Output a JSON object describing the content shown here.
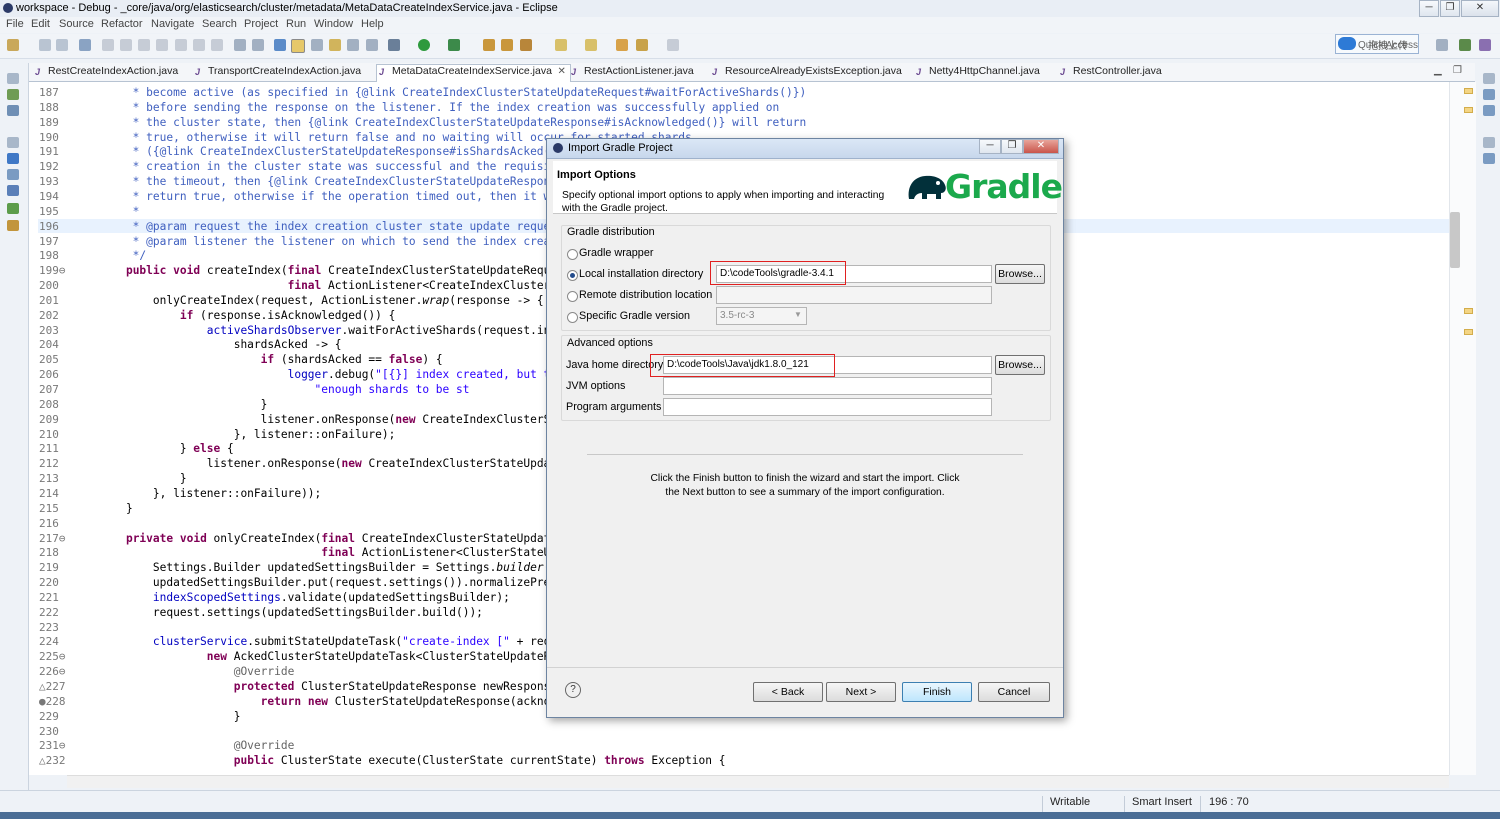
{
  "window": {
    "title": "workspace - Debug - _core/java/org/elasticsearch/cluster/metadata/MetaDataCreateIndexService.java - Eclipse",
    "controls": [
      "─",
      "❐",
      "✕"
    ]
  },
  "menu": [
    "File",
    "Edit",
    "Source",
    "Refactor",
    "Navigate",
    "Search",
    "Project",
    "Run",
    "Window",
    "Help"
  ],
  "toolbar": {
    "quick_access": "Quick Access",
    "cloud_label": "拖拽上传"
  },
  "tabs": [
    {
      "label": "RestCreateIndexAction.java",
      "active": false
    },
    {
      "label": "TransportCreateIndexAction.java",
      "active": false
    },
    {
      "label": "MetaDataCreateIndexService.java",
      "active": true
    },
    {
      "label": "RestActionListener.java",
      "active": false
    },
    {
      "label": "ResourceAlreadyExistsException.java",
      "active": false
    },
    {
      "label": "Netty4HttpChannel.java",
      "active": false
    },
    {
      "label": "RestController.java",
      "active": false
    }
  ],
  "editor": {
    "lines": [
      {
        "n": "187",
        "segs": [
          [
            "cm",
            "     * become active (as specified in {@link CreateIndexClusterStateUpdateRequest#waitForActiveShards()})"
          ]
        ]
      },
      {
        "n": "188",
        "segs": [
          [
            "cm",
            "     * before sending the response on the listener. If the index creation was successfully applied on"
          ]
        ]
      },
      {
        "n": "189",
        "segs": [
          [
            "cm",
            "     * the cluster state, then {@link CreateIndexClusterStateUpdateResponse#isAcknowledged()} will return"
          ]
        ]
      },
      {
        "n": "190",
        "segs": [
          [
            "cm",
            "     * true, otherwise it will return false and no waiting will occur for started shards"
          ]
        ]
      },
      {
        "n": "191",
        "segs": [
          [
            "cm",
            "     * ({@link CreateIndexClusterStateUpdateResponse#isShardsAcked()"
          ]
        ]
      },
      {
        "n": "192",
        "segs": [
          [
            "cm",
            "     * creation in the cluster state was successful and the requisite"
          ]
        ]
      },
      {
        "n": "193",
        "segs": [
          [
            "cm",
            "     * the timeout, then {@link CreateIndexClusterStateUpdateRespons"
          ]
        ]
      },
      {
        "n": "194",
        "segs": [
          [
            "cm",
            "     * return true, otherwise if the operation timed out, then it wi"
          ]
        ]
      },
      {
        "n": "195",
        "segs": [
          [
            "cm",
            "     *"
          ]
        ]
      },
      {
        "n": "196",
        "hl": true,
        "segs": [
          [
            "cm",
            "     * @param request the index creation cluster state update reques"
          ]
        ]
      },
      {
        "n": "197",
        "segs": [
          [
            "cm",
            "     * @param listener the listener on which to send the index creat"
          ]
        ]
      },
      {
        "n": "198",
        "segs": [
          [
            "cm",
            "     */"
          ]
        ]
      },
      {
        "n": "199⊖",
        "segs": [
          [
            "",
            "    "
          ],
          [
            "kw",
            "public"
          ],
          [
            "",
            " "
          ],
          [
            "kw",
            "void"
          ],
          [
            "",
            " createIndex("
          ],
          [
            "kw",
            "final"
          ],
          [
            "",
            " CreateIndexClusterStateUpdateReque"
          ]
        ]
      },
      {
        "n": "200",
        "segs": [
          [
            "",
            "                            "
          ],
          [
            "kw",
            "final"
          ],
          [
            "",
            " ActionListener<CreateIndexClusterS"
          ]
        ]
      },
      {
        "n": "201",
        "segs": [
          [
            "",
            "        onlyCreateIndex(request, ActionListener."
          ],
          [
            "it",
            "wrap"
          ],
          [
            "",
            "(response -> {"
          ]
        ]
      },
      {
        "n": "202",
        "segs": [
          [
            "",
            "            "
          ],
          [
            "kw",
            "if"
          ],
          [
            "",
            " (response.isAcknowledged()) {"
          ]
        ]
      },
      {
        "n": "203",
        "segs": [
          [
            "",
            "                "
          ],
          [
            "fld",
            "activeShardsObserver"
          ],
          [
            "",
            ".waitForActiveShards(request.ind"
          ]
        ]
      },
      {
        "n": "204",
        "segs": [
          [
            "",
            "                    shardsAcked -> {"
          ]
        ]
      },
      {
        "n": "205",
        "segs": [
          [
            "",
            "                        "
          ],
          [
            "kw",
            "if"
          ],
          [
            "",
            " (shardsAcked == "
          ],
          [
            "kw",
            "false"
          ],
          [
            "",
            ") {"
          ]
        ]
      },
      {
        "n": "206",
        "segs": [
          [
            "",
            "                            "
          ],
          [
            "fld",
            "logger"
          ],
          [
            "",
            ".debug("
          ],
          [
            "str",
            "\"[{}] index created, but th"
          ]
        ]
      },
      {
        "n": "207",
        "segs": [
          [
            "",
            "                                "
          ],
          [
            "str",
            "\"enough shards to be st"
          ]
        ]
      },
      {
        "n": "208",
        "segs": [
          [
            "",
            "                        }"
          ]
        ]
      },
      {
        "n": "209",
        "segs": [
          [
            "",
            "                        listener.onResponse("
          ],
          [
            "kw",
            "new"
          ],
          [
            "",
            " CreateIndexClusterSt"
          ]
        ]
      },
      {
        "n": "210",
        "segs": [
          [
            "",
            "                    }, listener::onFailure);"
          ]
        ]
      },
      {
        "n": "211",
        "segs": [
          [
            "",
            "            } "
          ],
          [
            "kw",
            "else"
          ],
          [
            "",
            " {"
          ]
        ]
      },
      {
        "n": "212",
        "segs": [
          [
            "",
            "                listener.onResponse("
          ],
          [
            "kw",
            "new"
          ],
          [
            "",
            " CreateIndexClusterStateUpdat"
          ]
        ]
      },
      {
        "n": "213",
        "segs": [
          [
            "",
            "            }"
          ]
        ]
      },
      {
        "n": "214",
        "segs": [
          [
            "",
            "        }, listener::onFailure));"
          ]
        ]
      },
      {
        "n": "215",
        "segs": [
          [
            "",
            "    }"
          ]
        ]
      },
      {
        "n": "216",
        "segs": [
          [
            "",
            ""
          ]
        ]
      },
      {
        "n": "217⊖",
        "segs": [
          [
            "",
            "    "
          ],
          [
            "kw",
            "private"
          ],
          [
            "",
            " "
          ],
          [
            "kw",
            "void"
          ],
          [
            "",
            " onlyCreateIndex("
          ],
          [
            "kw",
            "final"
          ],
          [
            "",
            " CreateIndexClusterStateUpdate"
          ]
        ]
      },
      {
        "n": "218",
        "segs": [
          [
            "",
            "                                 "
          ],
          [
            "kw",
            "final"
          ],
          [
            "",
            " ActionListener<ClusterStateUp"
          ]
        ]
      },
      {
        "n": "219",
        "segs": [
          [
            "",
            "        Settings.Builder updatedSettingsBuilder = Settings."
          ],
          [
            "it",
            "builder"
          ],
          [
            "",
            "()"
          ]
        ]
      },
      {
        "n": "220",
        "segs": [
          [
            "",
            "        updatedSettingsBuilder.put(request.settings()).normalizePref"
          ]
        ]
      },
      {
        "n": "221",
        "segs": [
          [
            "",
            "        "
          ],
          [
            "fld",
            "indexScopedSettings"
          ],
          [
            "",
            ".validate(updatedSettingsBuilder);"
          ]
        ]
      },
      {
        "n": "222",
        "segs": [
          [
            "",
            "        request.settings(updatedSettingsBuilder.build());"
          ]
        ]
      },
      {
        "n": "223",
        "segs": [
          [
            "",
            ""
          ]
        ]
      },
      {
        "n": "224",
        "segs": [
          [
            "",
            "        "
          ],
          [
            "fld",
            "clusterService"
          ],
          [
            "",
            ".submitStateUpdateTask("
          ],
          [
            "str",
            "\"create-index [\""
          ],
          [
            "",
            " + requ"
          ]
        ]
      },
      {
        "n": "225⊖",
        "segs": [
          [
            "",
            "                "
          ],
          [
            "kw",
            "new"
          ],
          [
            "",
            " AckedClusterStateUpdateTask<ClusterStateUpdateRe"
          ]
        ]
      },
      {
        "n": "226⊖",
        "segs": [
          [
            "ann",
            "                    @Override"
          ]
        ]
      },
      {
        "n": "△227",
        "segs": [
          [
            "",
            "                    "
          ],
          [
            "kw",
            "protected"
          ],
          [
            "",
            " ClusterStateUpdateResponse newResponse"
          ]
        ]
      },
      {
        "n": "●228",
        "segs": [
          [
            "",
            "                        "
          ],
          [
            "kw",
            "return"
          ],
          [
            "",
            " "
          ],
          [
            "kw",
            "new"
          ],
          [
            "",
            " ClusterStateUpdateResponse(ackno"
          ]
        ]
      },
      {
        "n": "229",
        "segs": [
          [
            "",
            "                    }"
          ]
        ]
      },
      {
        "n": "230",
        "segs": [
          [
            "",
            ""
          ]
        ]
      },
      {
        "n": "231⊖",
        "segs": [
          [
            "ann",
            "                    @Override"
          ]
        ]
      },
      {
        "n": "△232",
        "segs": [
          [
            "",
            "                    "
          ],
          [
            "kw",
            "public"
          ],
          [
            "",
            " ClusterState execute(ClusterState currentState) "
          ],
          [
            "kw",
            "throws"
          ],
          [
            "",
            " Exception {"
          ]
        ]
      }
    ]
  },
  "status": {
    "writable": "Writable",
    "insert_mode": "Smart Insert",
    "position": "196 : 70"
  },
  "dialog": {
    "title": "Import Gradle Project",
    "header_title": "Import Options",
    "header_desc": "Specify optional import options to apply when importing and interacting with the Gradle project.",
    "logo_text": "Gradle",
    "distribution": {
      "label": "Gradle distribution",
      "wrapper_label": "Gradle wrapper",
      "local_label": "Local installation directory",
      "local_value": "D:\\codeTools\\gradle-3.4.1",
      "remote_label": "Remote distribution location",
      "remote_value": "",
      "version_label": "Specific Gradle version",
      "version_value": "3.5-rc-3",
      "browse": "Browse..."
    },
    "advanced": {
      "label": "Advanced options",
      "java_home_label": "Java home directory",
      "java_home_value": "D:\\codeTools\\Java\\jdk1.8.0_121",
      "jvm_label": "JVM options",
      "jvm_value": "",
      "args_label": "Program arguments",
      "args_value": "",
      "browse": "Browse..."
    },
    "info_line1": "Click the Finish button to finish the wizard and start the import. Click",
    "info_line2": "the Next button to see a summary of the import configuration.",
    "help": "?",
    "buttons": {
      "back": "< Back",
      "next": "Next >",
      "finish": "Finish",
      "cancel": "Cancel"
    },
    "title_controls": [
      "─",
      "❐",
      "✕"
    ]
  }
}
